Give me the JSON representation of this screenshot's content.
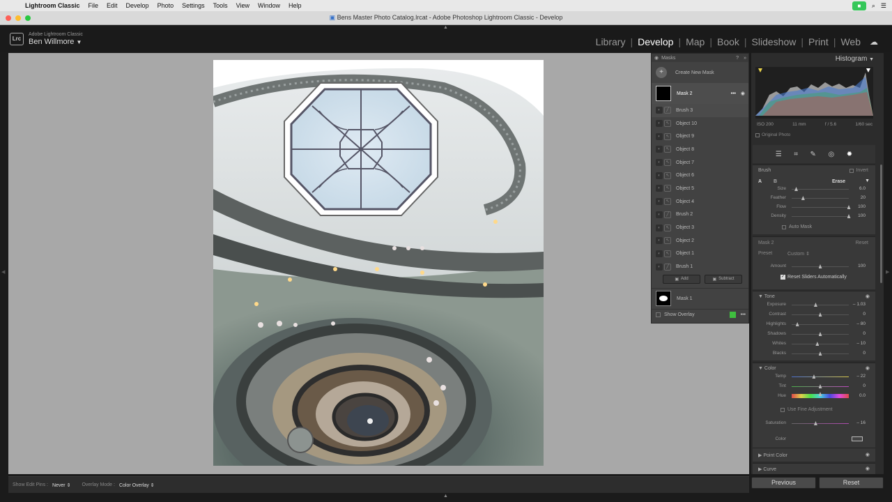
{
  "menubar": {
    "app": "Lightroom Classic",
    "items": [
      "File",
      "Edit",
      "Develop",
      "Photo",
      "Settings",
      "Tools",
      "View",
      "Window",
      "Help"
    ]
  },
  "window_title": "Bens Master Photo Catalog.lrcat - Adobe Photoshop Lightroom Classic - Develop",
  "identity": {
    "logo": "Lrc",
    "brand": "Adobe Lightroom Classic",
    "user": "Ben Willmore"
  },
  "modules": [
    {
      "label": "Library",
      "active": false
    },
    {
      "label": "Develop",
      "active": true
    },
    {
      "label": "Map",
      "active": false
    },
    {
      "label": "Book",
      "active": false
    },
    {
      "label": "Slideshow",
      "active": false
    },
    {
      "label": "Print",
      "active": false
    },
    {
      "label": "Web",
      "active": false
    }
  ],
  "masks_panel": {
    "title": "Masks",
    "create_label": "Create New Mask",
    "mask2_label": "Mask 2",
    "components": [
      "Brush 3",
      "Object 10",
      "Object 9",
      "Object 8",
      "Object 7",
      "Object 6",
      "Object 5",
      "Object 4",
      "Brush 2",
      "Object 3",
      "Object 2",
      "Object 1",
      "Brush 1"
    ],
    "add_label": "Add",
    "subtract_label": "Subtract",
    "mask1_label": "Mask 1",
    "show_overlay_label": "Show Overlay",
    "overlay_color": "#3fbf3f"
  },
  "toolbar": {
    "show_edit_pins_label": "Show Edit Pins :",
    "show_edit_pins_value": "Never",
    "overlay_mode_label": "Overlay Mode :",
    "overlay_mode_value": "Color Overlay"
  },
  "histogram": {
    "title": "Histogram",
    "iso": "ISO 200",
    "focal": "11 mm",
    "aperture": "f / 5.6",
    "shutter": "1/60 sec",
    "original_photo_label": "Original Photo"
  },
  "brush": {
    "title": "Brush",
    "invert_label": "Invert",
    "a_label": "A",
    "b_label": "B",
    "erase_label": "Erase",
    "sliders": [
      {
        "name": "Size",
        "value": "6.0",
        "pos": 0.08
      },
      {
        "name": "Feather",
        "value": "20",
        "pos": 0.2
      },
      {
        "name": "Flow",
        "value": "100",
        "pos": 1.0
      },
      {
        "name": "Density",
        "value": "100",
        "pos": 1.0
      }
    ],
    "auto_mask_label": "Auto Mask"
  },
  "mask_settings": {
    "title": "Mask 2",
    "reset_label": "Reset",
    "preset_label": "Preset",
    "preset_value": "Custom",
    "amount_label": "Amount",
    "amount_value": "100",
    "amount_pos": 0.5,
    "reset_sliders_label": "Reset Sliders Automatically"
  },
  "tone": {
    "title": "Tone",
    "sliders": [
      {
        "name": "Exposure",
        "value": "– 1.03",
        "pos": 0.42
      },
      {
        "name": "Contrast",
        "value": "0",
        "pos": 0.5
      },
      {
        "name": "Highlights",
        "value": "– 80",
        "pos": 0.1
      },
      {
        "name": "Shadows",
        "value": "0",
        "pos": 0.5
      },
      {
        "name": "Whites",
        "value": "– 10",
        "pos": 0.45
      },
      {
        "name": "Blacks",
        "value": "0",
        "pos": 0.5
      }
    ]
  },
  "color": {
    "title": "Color",
    "sliders": [
      {
        "name": "Temp",
        "value": "– 22",
        "pos": 0.39
      },
      {
        "name": "Tint",
        "value": "0",
        "pos": 0.5
      },
      {
        "name": "Hue",
        "value": "0.0",
        "pos": 0.5
      }
    ],
    "fine_adjust_label": "Use Fine Adjustment",
    "saturation_label": "Saturation",
    "saturation_value": "– 16",
    "saturation_pos": 0.42,
    "color_label": "Color"
  },
  "sections": {
    "point_color": "Point Color",
    "curve": "Curve"
  },
  "buttons": {
    "previous": "Previous",
    "reset": "Reset"
  }
}
